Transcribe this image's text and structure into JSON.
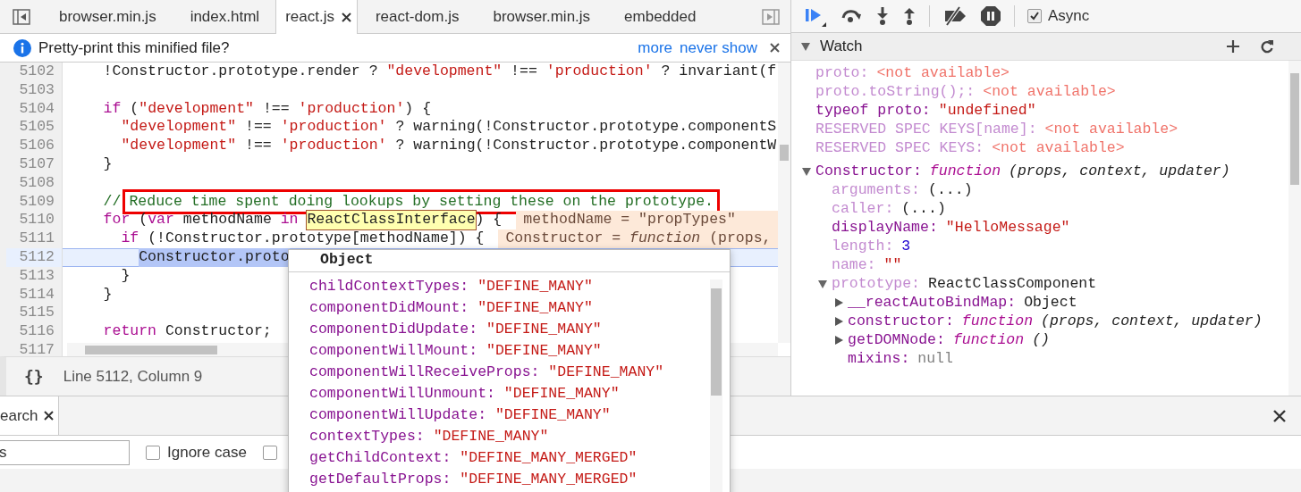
{
  "editor": {
    "tabs": [
      {
        "label": "browser.min.js",
        "selected": false,
        "closable": false
      },
      {
        "label": "index.html",
        "selected": false,
        "closable": false
      },
      {
        "label": "react.js",
        "selected": true,
        "closable": true
      },
      {
        "label": "react-dom.js",
        "selected": false,
        "closable": false
      },
      {
        "label": "browser.min.js",
        "selected": false,
        "closable": false
      },
      {
        "label": "embedded",
        "selected": false,
        "closable": false
      }
    ],
    "infobar": {
      "message": "Pretty-print this minified file?",
      "links": [
        "more",
        "never show"
      ]
    },
    "lines": [
      {
        "number": "5102",
        "current": false,
        "tokens": [
          {
            "kind": "plain",
            "text": "    !Constructor.prototype.render ? "
          },
          {
            "kind": "string",
            "text": "\"development\""
          },
          {
            "kind": "plain",
            "text": " !== "
          },
          {
            "kind": "string",
            "text": "'production'"
          },
          {
            "kind": "plain",
            "text": " ? invariant(f"
          }
        ]
      },
      {
        "number": "5103",
        "current": false
      },
      {
        "number": "5104",
        "current": false,
        "tokens": [
          {
            "kind": "keyword",
            "text": "    if"
          },
          {
            "kind": "plain",
            "text": " ("
          },
          {
            "kind": "string",
            "text": "\"development\""
          },
          {
            "kind": "plain",
            "text": " !== "
          },
          {
            "kind": "string",
            "text": "'production'"
          },
          {
            "kind": "plain",
            "text": ") {"
          }
        ]
      },
      {
        "number": "5105",
        "current": false,
        "tokens": [
          {
            "kind": "string",
            "text": "      \"development\""
          },
          {
            "kind": "plain",
            "text": " !== "
          },
          {
            "kind": "string",
            "text": "'production'"
          },
          {
            "kind": "plain",
            "text": " ? warning(!Constructor.prototype.componentS"
          }
        ]
      },
      {
        "number": "5106",
        "current": false,
        "tokens": [
          {
            "kind": "string",
            "text": "      \"development\""
          },
          {
            "kind": "plain",
            "text": " !== "
          },
          {
            "kind": "string",
            "text": "'production'"
          },
          {
            "kind": "plain",
            "text": " ? warning(!Constructor.prototype.componentW"
          }
        ]
      },
      {
        "number": "5107",
        "current": false,
        "tokens": [
          {
            "kind": "plain",
            "text": "    }"
          }
        ]
      },
      {
        "number": "5108",
        "current": false
      },
      {
        "number": "5109",
        "current": false,
        "tokens": [
          {
            "kind": "comment",
            "text": "    //"
          },
          {
            "kind": "boxed-comment",
            "text": "Reduce time spent doing lookups by setting these on the prototype."
          }
        ]
      },
      {
        "number": "5110",
        "current": false,
        "tokens": [
          {
            "kind": "keyword",
            "text": "    for"
          },
          {
            "kind": "plain",
            "text": " ("
          },
          {
            "kind": "keyword",
            "text": "var"
          },
          {
            "kind": "plain",
            "text": " methodName "
          },
          {
            "kind": "keyword",
            "text": "in"
          },
          {
            "kind": "hover",
            "text": " ReactClassInterface"
          },
          {
            "kind": "plain",
            "text": ") {"
          }
        ],
        "inline_value": "methodName = \"propTypes\""
      },
      {
        "number": "5111",
        "current": false,
        "tokens": [
          {
            "kind": "keyword",
            "text": "      if"
          },
          {
            "kind": "plain",
            "text": " (!Constructor.prototype[methodName]) {"
          }
        ],
        "inline_value": "Constructor = *function* (props,"
      },
      {
        "number": "5112",
        "current": true,
        "tokens": [
          {
            "kind": "selection",
            "text": "        Constructor.proto"
          }
        ]
      },
      {
        "number": "5113",
        "current": false,
        "tokens": [
          {
            "kind": "plain",
            "text": "      }"
          }
        ]
      },
      {
        "number": "5114",
        "current": false,
        "tokens": [
          {
            "kind": "plain",
            "text": "    }"
          }
        ]
      },
      {
        "number": "5115",
        "current": false
      },
      {
        "number": "5116",
        "current": false,
        "tokens": [
          {
            "kind": "keyword",
            "text": "    return"
          },
          {
            "kind": "plain",
            "text": " Constructor;"
          }
        ]
      },
      {
        "number": "5117",
        "current": false
      }
    ],
    "status": {
      "format_button": "{}",
      "position": "Line 5112, Column 9"
    }
  },
  "popup": {
    "title": "Object",
    "properties": [
      {
        "name": "childContextTypes:",
        "value": "\"DEFINE_MANY\""
      },
      {
        "name": "componentDidMount:",
        "value": "\"DEFINE_MANY\""
      },
      {
        "name": "componentDidUpdate:",
        "value": "\"DEFINE_MANY\""
      },
      {
        "name": "componentWillMount:",
        "value": "\"DEFINE_MANY\""
      },
      {
        "name": "componentWillReceiveProps:",
        "value": "\"DEFINE_MANY\""
      },
      {
        "name": "componentWillUnmount:",
        "value": "\"DEFINE_MANY\""
      },
      {
        "name": "componentWillUpdate:",
        "value": "\"DEFINE_MANY\""
      },
      {
        "name": "contextTypes:",
        "value": "\"DEFINE_MANY\""
      },
      {
        "name": "getChildContext:",
        "value": "\"DEFINE_MANY_MERGED\""
      },
      {
        "name": "getDefaultProps:",
        "value": "\"DEFINE_MANY_MERGED\""
      }
    ]
  },
  "debugger": {
    "async": {
      "label": "Async",
      "checked": true
    },
    "watch": {
      "title": "Watch",
      "expanded": true,
      "entries": [
        {
          "name": "proto:",
          "value": "<not available>",
          "kind": "unavailable",
          "dimmed": true
        },
        {
          "name": "proto.toString();:",
          "value": "<not available>",
          "kind": "unavailable",
          "dimmed": true
        },
        {
          "name": "typeof proto:",
          "value": "\"undefined\"",
          "kind": "string",
          "dimmed": false
        },
        {
          "name": "RESERVED SPEC KEYS[name]:",
          "value": "<not available>",
          "kind": "unavailable",
          "dimmed": true
        },
        {
          "name": "RESERVED SPEC KEYS:",
          "value": "<not available>",
          "kind": "unavailable",
          "dimmed": true
        },
        {
          "name": "Constructor:",
          "kind": "function",
          "keyword": "function",
          "value": "(props, context, updater)",
          "dimmed": false,
          "expanded": true,
          "children": [
            {
              "name": "arguments:",
              "value": "(...)",
              "kind": "plain",
              "dimmed": true
            },
            {
              "name": "caller:",
              "value": "(...)",
              "kind": "plain",
              "dimmed": true
            },
            {
              "name": "displayName:",
              "value": "\"HelloMessage\"",
              "kind": "string",
              "dimmed": false
            },
            {
              "name": "length:",
              "value": "3",
              "kind": "number",
              "dimmed": true
            },
            {
              "name": "name:",
              "value": "\"\"",
              "kind": "string",
              "dimmed": true
            },
            {
              "name": "prototype:",
              "value": "ReactClassComponent",
              "kind": "plain",
              "dimmed": true,
              "expanded": true,
              "children": [
                {
                  "name": "__reactAutoBindMap:",
                  "value": "Object",
                  "kind": "plain",
                  "dimmed": false,
                  "expanded": false
                },
                {
                  "name": "constructor:",
                  "kind": "function",
                  "keyword": "function",
                  "value": "(props, context, updater)",
                  "dimmed": false,
                  "expanded": false
                },
                {
                  "name": "getDOMNode:",
                  "kind": "function",
                  "keyword": "function",
                  "value": "()",
                  "dimmed": false,
                  "expanded": false
                },
                {
                  "name": "mixins:",
                  "value": "null",
                  "kind": "null",
                  "dimmed": false
                }
              ]
            }
          ]
        }
      ]
    }
  },
  "drawer": {
    "tab": {
      "label": "earch",
      "selected": true
    },
    "search": {
      "value": "s"
    },
    "options": [
      {
        "label": "Ignore case",
        "checked": false
      },
      {
        "checked": false
      }
    ]
  }
}
